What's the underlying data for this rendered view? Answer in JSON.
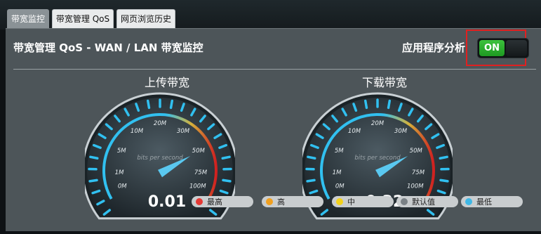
{
  "tabs": [
    {
      "label": "带宽监控",
      "active": true
    },
    {
      "label": "带宽管理 QoS",
      "active": false
    },
    {
      "label": "网页浏览历史",
      "active": false
    }
  ],
  "header": {
    "title": "带宽管理 QoS - WAN / LAN 带宽监控",
    "analysis_label": "应用程序分析",
    "toggle_label": "ON"
  },
  "gauges": [
    {
      "title": "上传带宽",
      "unit_label": "bits per second",
      "value": "0.01",
      "ticks": [
        "0M",
        "1M",
        "5M",
        "10M",
        "20M",
        "30M",
        "50M",
        "75M",
        "100M"
      ]
    },
    {
      "title": "下载带宽",
      "unit_label": "bits per second",
      "value": "0.32",
      "ticks": [
        "0M",
        "1M",
        "5M",
        "10M",
        "20M",
        "30M",
        "50M",
        "75M",
        "100M"
      ]
    }
  ],
  "legend": [
    {
      "label": "最高",
      "color": "#e53935"
    },
    {
      "label": "高",
      "color": "#f0a020"
    },
    {
      "label": "中",
      "color": "#f3d21c"
    },
    {
      "label": "默认值",
      "color": "#7a8186"
    },
    {
      "label": "最低",
      "color": "#3fb8e6"
    }
  ],
  "colors": {
    "accent_blue": "#31c0f0",
    "toggle_green": "#2eb52e",
    "highlight_red": "#e02020"
  }
}
